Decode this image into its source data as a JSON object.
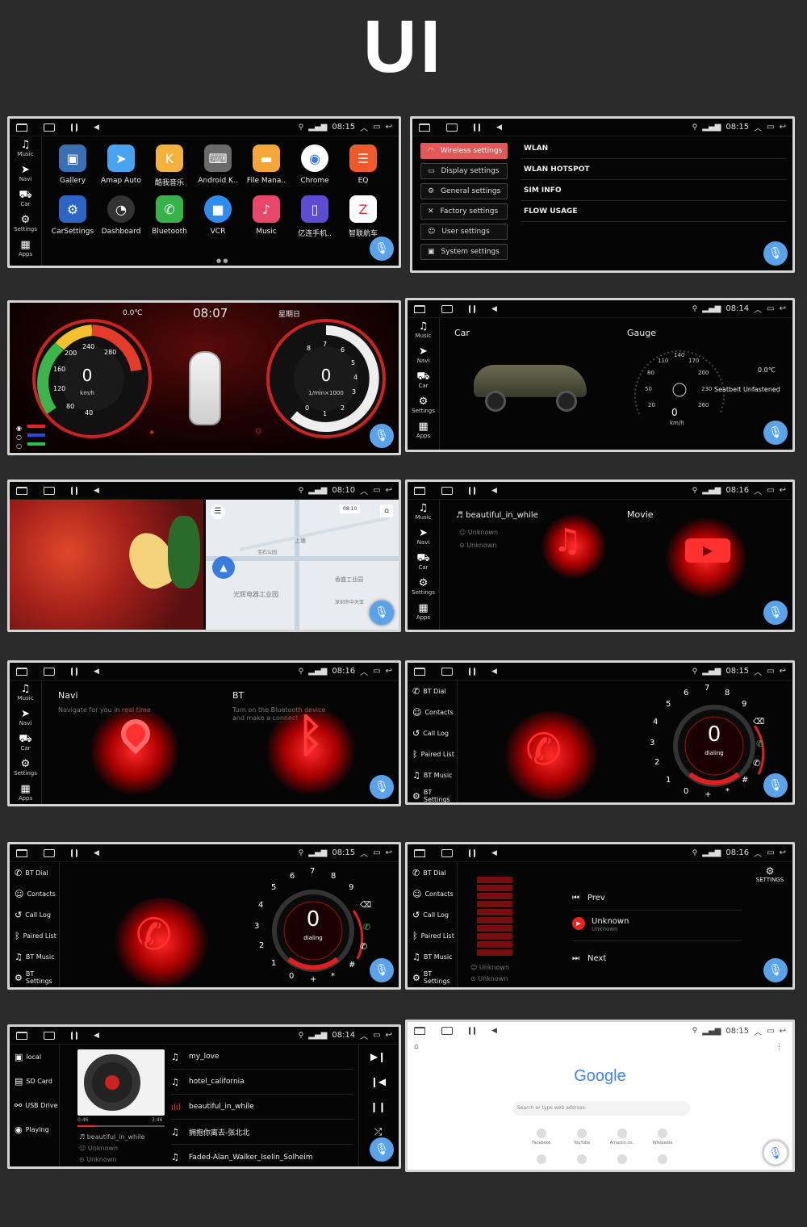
{
  "title": "UI",
  "status": {
    "t1": "08:15",
    "t2": "08:15",
    "t3": "08:14",
    "t4": "08:10",
    "t5": "08:16",
    "t6": "08:16",
    "t7": "08:15",
    "t8": "08:15",
    "t9": "08:16",
    "t10": "08:14",
    "t11": "08:15"
  },
  "sidebar": {
    "music": "Music",
    "navi": "Navi",
    "car": "Car",
    "settings": "Settings",
    "apps": "Apps"
  },
  "launcher": {
    "apps": [
      "Gallery",
      "Amap Auto",
      "酷我音乐",
      "Android K..",
      "File Mana..",
      "Chrome",
      "EQ",
      "CarSettings",
      "Dashboard",
      "Bluetooth",
      "VCR",
      "Music",
      "亿连手机..",
      "智联航车"
    ]
  },
  "settings": {
    "menu": [
      "Wireless settings",
      "Display settings",
      "General settings",
      "Factory settings",
      "User settings",
      "System settings"
    ],
    "list": [
      "WLAN",
      "WLAN HOTSPOT",
      "SIM INFO",
      "FLOW USAGE"
    ]
  },
  "dashboard": {
    "temp": "0.0℃",
    "time": "08:07",
    "day": "星期日",
    "speed": "0",
    "speed_unit": "km/h",
    "rpm": "0",
    "rpm_unit": "1/min×1000",
    "speed_ticks": [
      "240",
      "280",
      "200",
      "160",
      "120",
      "80",
      "40"
    ],
    "rpm_ticks": [
      "8",
      "7",
      "6",
      "5",
      "4",
      "3",
      "2",
      "1",
      "0"
    ]
  },
  "car": {
    "car_title": "Car",
    "gauge_title": "Gauge",
    "speed": "0",
    "unit": "km/h",
    "temp": "0.0℃",
    "seatbelt": "Seatbelt Unfastened",
    "ticks": [
      "140",
      "110",
      "170",
      "80",
      "200",
      "50",
      "230",
      "20",
      "260"
    ]
  },
  "map": {
    "time": "08:10",
    "labels": [
      "光辉电器工业园",
      "香盛工业园",
      "上塘",
      "深圳市中天亚",
      "宝石公园"
    ]
  },
  "media": {
    "song": "beautiful_in_while",
    "artist": "Unknown",
    "album": "Unknown",
    "movie": "Movie"
  },
  "navbt": {
    "navi": "Navi",
    "navi_sub": "Navigate for you in real time",
    "bt": "BT",
    "bt_sub": "Turn on the Bluetooth device and make a connect"
  },
  "bt": {
    "menu": [
      "BT Dial",
      "Contacts",
      "Call Log",
      "Paired List",
      "BT Music",
      "BT Settings"
    ],
    "dial_value": "0",
    "dial_label": "dialing",
    "digits": [
      "1",
      "2",
      "3",
      "4",
      "5",
      "6",
      "7",
      "8",
      "9",
      "0",
      "*",
      "#",
      "+"
    ],
    "prev": "Prev",
    "next": "Next",
    "track": "Unknown",
    "track_sub": "Unknown",
    "settings_label": "SETTINGS",
    "artist": "Unknown",
    "album": "Unknown"
  },
  "player": {
    "sources": [
      "local",
      "SD Card",
      "USB Drive",
      "Playing"
    ],
    "elapsed": "0:46",
    "total": "3:46",
    "song": "beautiful_in_while",
    "artist": "Unknown",
    "album": "Unknown",
    "tracks": [
      "my_love",
      "hotel_california",
      "beautiful_in_while",
      "拥抱你离去-张北北",
      "Faded-Alan_Walker_Iselin_Solheim"
    ]
  },
  "browser": {
    "logo": "Google",
    "search_placeholder": "Search or type web address",
    "shortcuts": [
      "Facebook",
      "YouTube",
      "Amazon.co..",
      "Wikipedia"
    ]
  }
}
